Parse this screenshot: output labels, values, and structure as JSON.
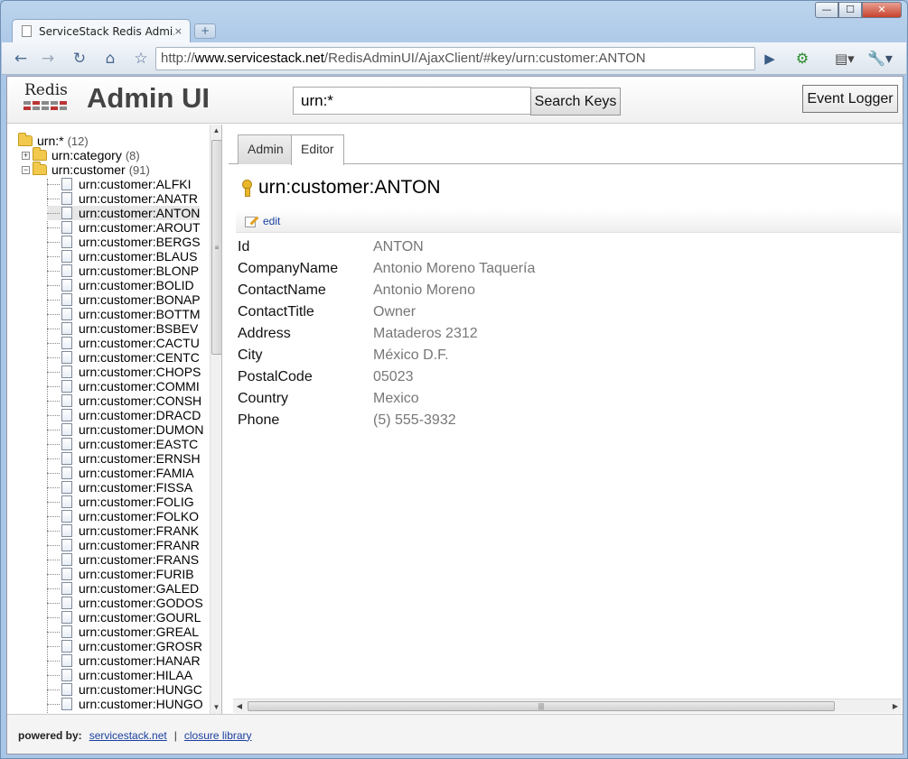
{
  "browser": {
    "tab_title": "ServiceStack Redis Admi...",
    "tab_close": "×",
    "new_tab": "+",
    "url_scheme": "http://",
    "url_host": "www.servicestack.net",
    "url_path": "/RedisAdminUI/AjaxClient/#key/urn:customer:ANTON",
    "back_icon": "back-arrow-icon",
    "forward_icon": "forward-arrow-icon",
    "window_controls": {
      "minimize": "—",
      "maximize": "☐",
      "close": "✕"
    }
  },
  "header": {
    "logo_text": "Redis",
    "title": "Admin UI",
    "search_value": "urn:*",
    "search_button": "Search Keys",
    "event_logger_button": "Event Logger"
  },
  "tree": {
    "root": {
      "label": "urn:*",
      "count": "(12)"
    },
    "category": {
      "label": "urn:category",
      "count": "(8)"
    },
    "customer": {
      "label": "urn:customer",
      "count": "(91)"
    },
    "items": [
      "urn:customer:ALFKI",
      "urn:customer:ANATR",
      "urn:customer:ANTON",
      "urn:customer:AROUT",
      "urn:customer:BERGS",
      "urn:customer:BLAUS",
      "urn:customer:BLONP",
      "urn:customer:BOLID",
      "urn:customer:BONAP",
      "urn:customer:BOTTM",
      "urn:customer:BSBEV",
      "urn:customer:CACTU",
      "urn:customer:CENTC",
      "urn:customer:CHOPS",
      "urn:customer:COMMI",
      "urn:customer:CONSH",
      "urn:customer:DRACD",
      "urn:customer:DUMON",
      "urn:customer:EASTC",
      "urn:customer:ERNSH",
      "urn:customer:FAMIA",
      "urn:customer:FISSA",
      "urn:customer:FOLIG",
      "urn:customer:FOLKO",
      "urn:customer:FRANK",
      "urn:customer:FRANR",
      "urn:customer:FRANS",
      "urn:customer:FURIB",
      "urn:customer:GALED",
      "urn:customer:GODOS",
      "urn:customer:GOURL",
      "urn:customer:GREAL",
      "urn:customer:GROSR",
      "urn:customer:HANAR",
      "urn:customer:HILAA",
      "urn:customer:HUNGC",
      "urn:customer:HUNGO"
    ],
    "selected": "urn:customer:ANTON"
  },
  "tabs": {
    "admin": "Admin",
    "editor": "Editor"
  },
  "editor": {
    "key": "urn:customer:ANTON",
    "edit_label": "edit",
    "fields": [
      {
        "name": "Id",
        "value": "ANTON"
      },
      {
        "name": "CompanyName",
        "value": "Antonio Moreno Taquería"
      },
      {
        "name": "ContactName",
        "value": "Antonio Moreno"
      },
      {
        "name": "ContactTitle",
        "value": "Owner"
      },
      {
        "name": "Address",
        "value": "Mataderos 2312"
      },
      {
        "name": "City",
        "value": "México D.F."
      },
      {
        "name": "PostalCode",
        "value": "05023"
      },
      {
        "name": "Country",
        "value": "Mexico"
      },
      {
        "name": "Phone",
        "value": "(5) 555-3932"
      }
    ]
  },
  "footer": {
    "powered_by": "powered by:",
    "link1": "servicestack.net",
    "separator": "|",
    "link2": "closure library"
  }
}
